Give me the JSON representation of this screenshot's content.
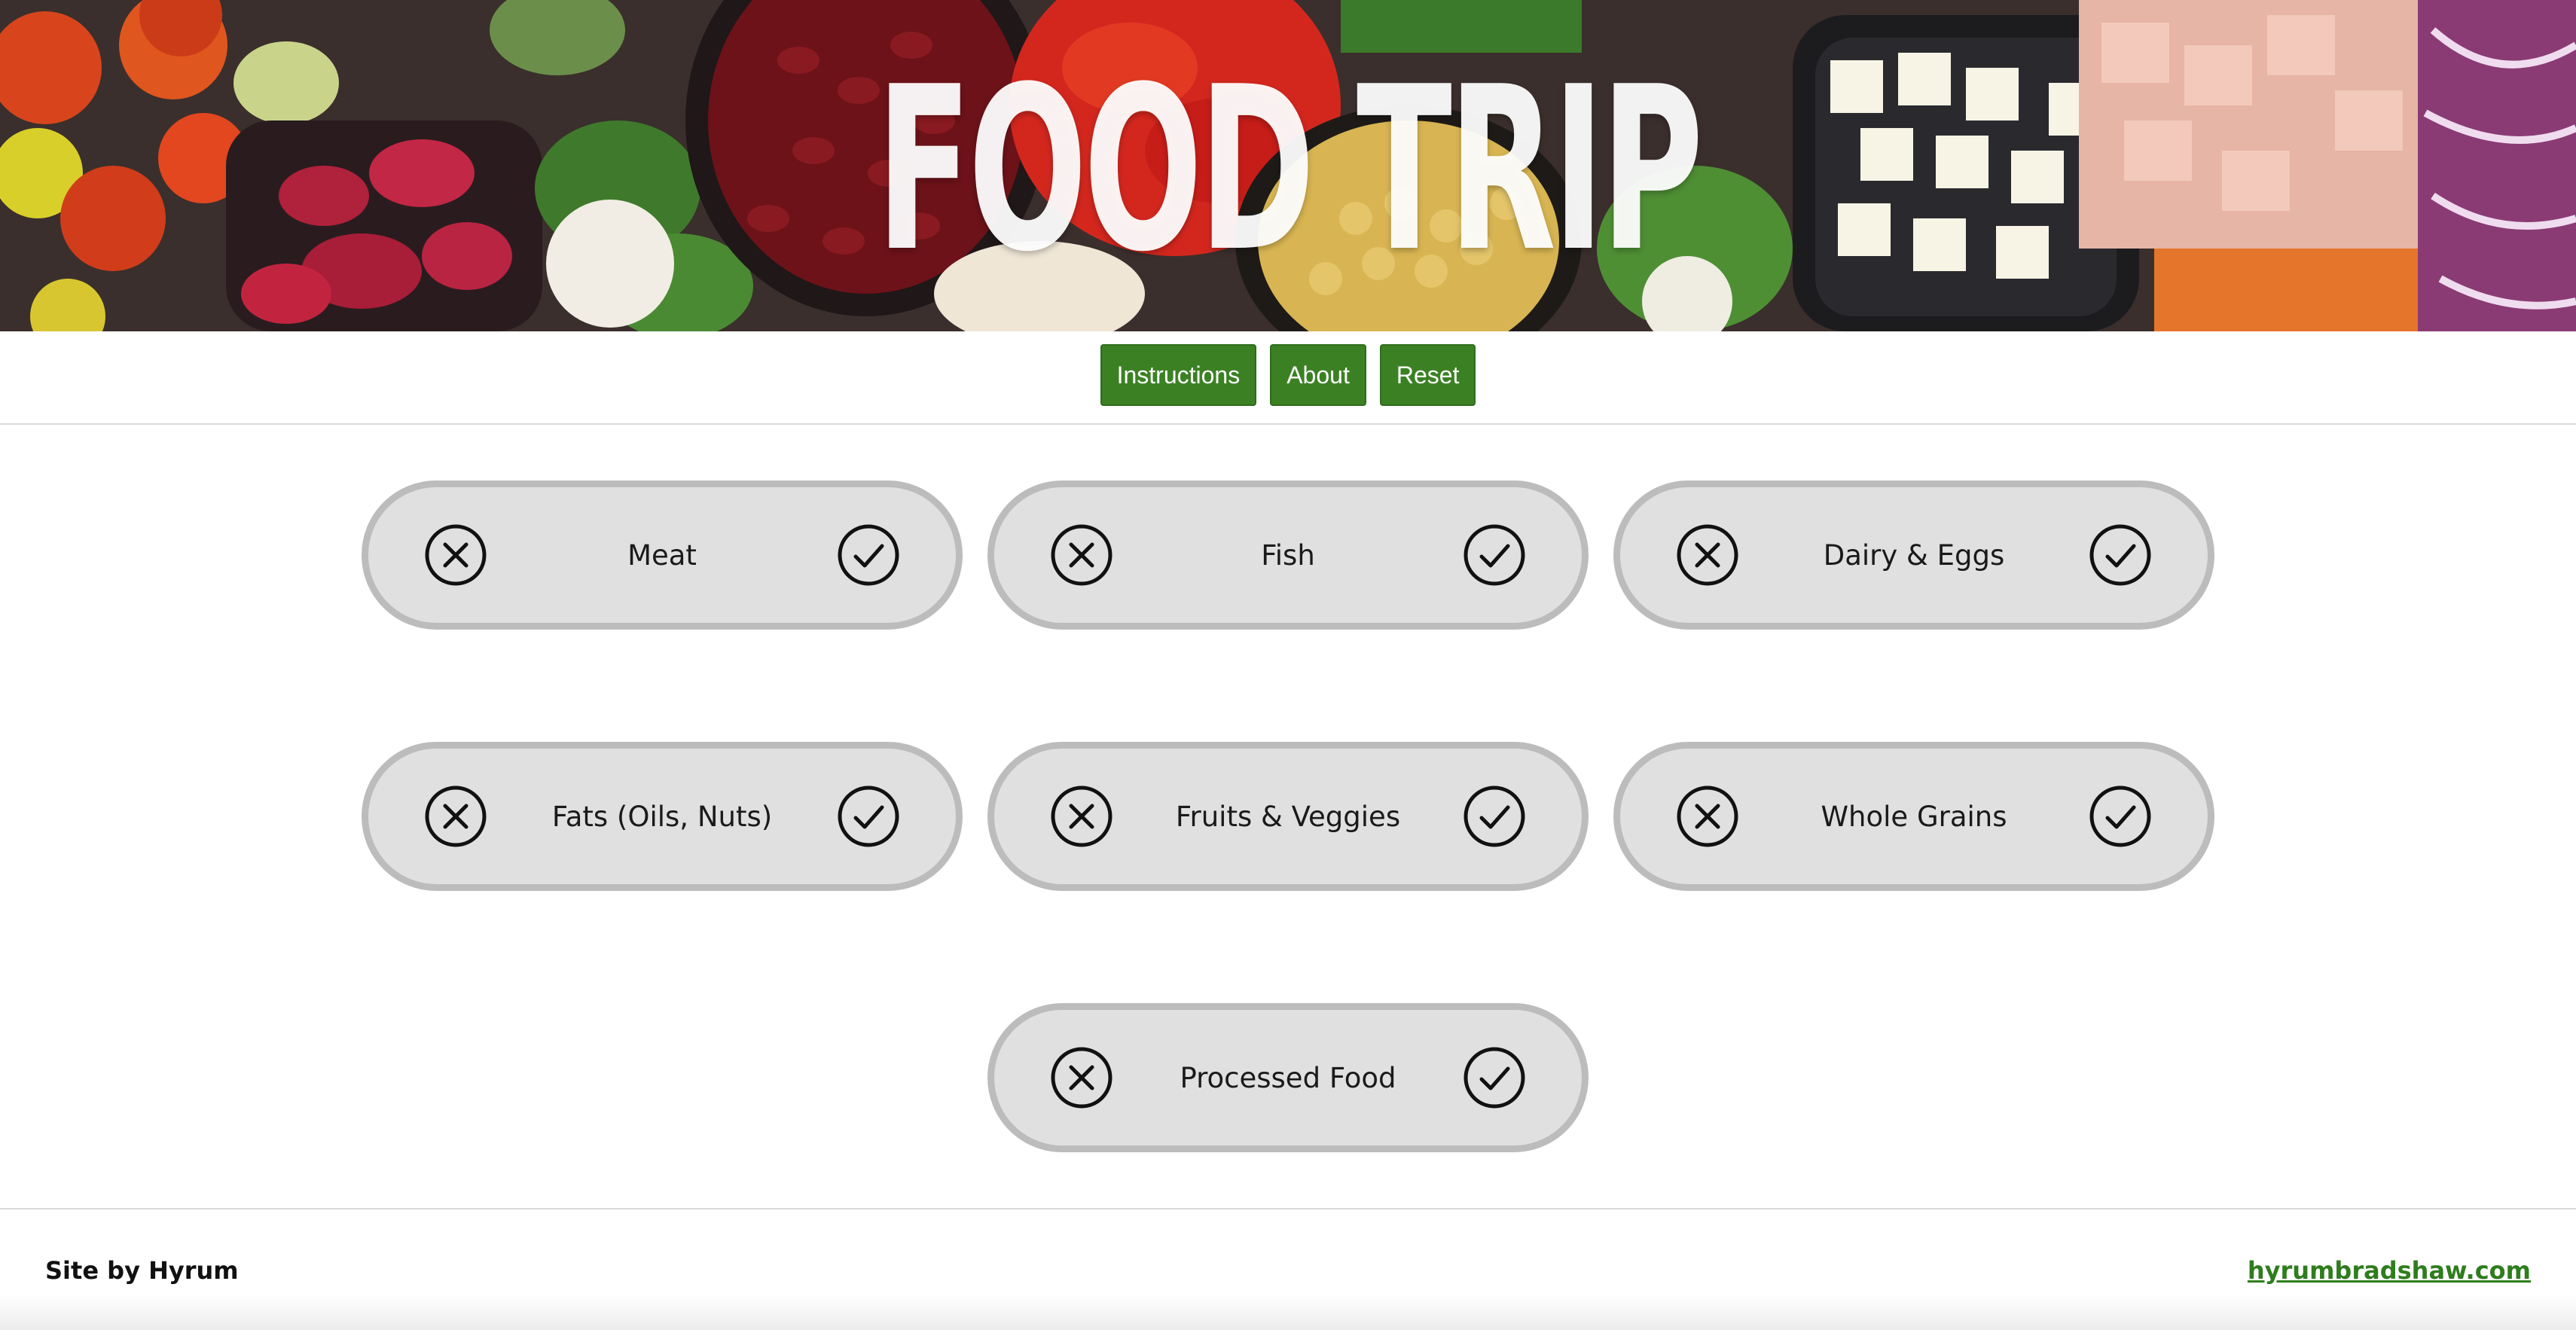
{
  "hero": {
    "title": "FOOD TRIP"
  },
  "toolbar": {
    "instructions_label": "Instructions",
    "about_label": "About",
    "reset_label": "Reset"
  },
  "categories": [
    {
      "label": "Meat"
    },
    {
      "label": "Fish"
    },
    {
      "label": "Dairy & Eggs"
    },
    {
      "label": "Fats (Oils, Nuts)"
    },
    {
      "label": "Fruits & Veggies"
    },
    {
      "label": "Whole Grains"
    },
    {
      "label": "Processed Food"
    }
  ],
  "icons": {
    "reject": "close-circle-icon",
    "accept": "check-circle-icon"
  },
  "colors": {
    "button_green": "#3b8124",
    "link_green": "#2f7d1e",
    "pill_fill": "#e0e0e0",
    "pill_border": "#bcbcbc"
  },
  "footer": {
    "credit": "Site by Hyrum",
    "link": "hyrumbradshaw.com"
  }
}
